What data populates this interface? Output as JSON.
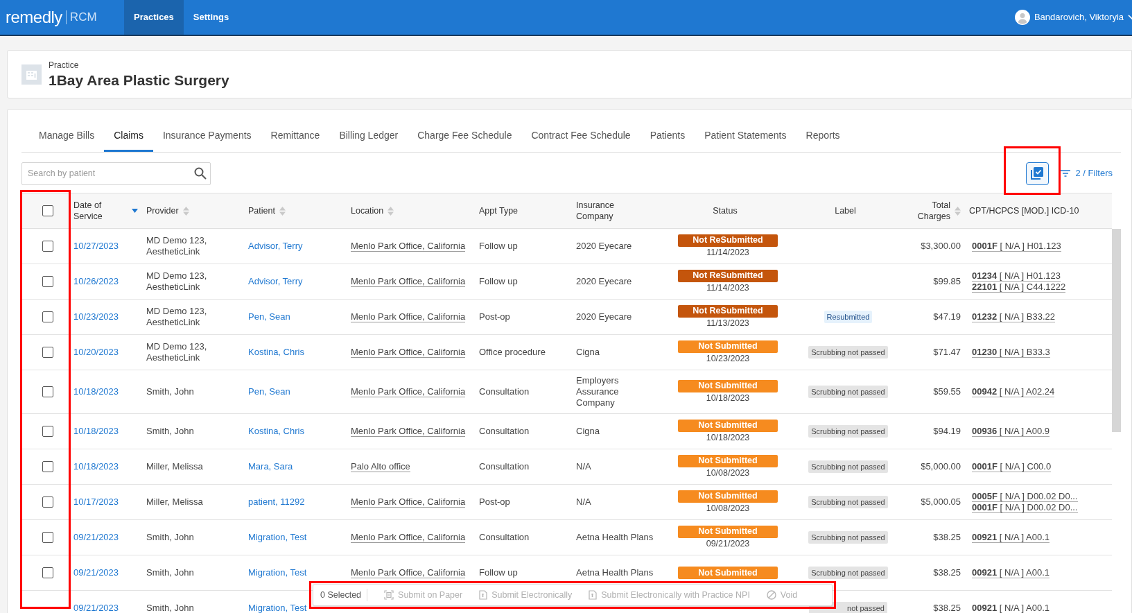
{
  "topbar": {
    "logo": "remedly",
    "product": "RCM",
    "nav": [
      {
        "label": "Practices",
        "selected": true
      },
      {
        "label": "Settings",
        "selected": false
      }
    ],
    "user": "Bandarovich, Viktoryia"
  },
  "practice": {
    "caption": "Practice",
    "name": "1Bay Area Plastic Surgery"
  },
  "tabs": [
    {
      "label": "Manage Bills",
      "selected": false
    },
    {
      "label": "Claims",
      "selected": true
    },
    {
      "label": "Insurance Payments",
      "selected": false
    },
    {
      "label": "Remittance",
      "selected": false
    },
    {
      "label": "Billing Ledger",
      "selected": false
    },
    {
      "label": "Charge Fee Schedule",
      "selected": false
    },
    {
      "label": "Contract Fee Schedule",
      "selected": false
    },
    {
      "label": "Patients",
      "selected": false
    },
    {
      "label": "Patient Statements",
      "selected": false
    },
    {
      "label": "Reports",
      "selected": false
    }
  ],
  "search": {
    "placeholder": "Search by patient"
  },
  "filters": {
    "label": "2 / Filters"
  },
  "table": {
    "select_all": {
      "checked": false
    },
    "columns": [
      {
        "label": "Date of Service",
        "sortable": true,
        "sorted": true
      },
      {
        "label": "Provider",
        "sortable": true,
        "sorted": false
      },
      {
        "label": "Patient",
        "sortable": true,
        "sorted": false
      },
      {
        "label": "Location",
        "sortable": true,
        "sorted": false
      },
      {
        "label": "Appt Type",
        "sortable": false
      },
      {
        "label": "Insurance Company",
        "sortable": false
      },
      {
        "label": "Status",
        "sortable": false
      },
      {
        "label": "Label",
        "sortable": false
      },
      {
        "label": "Total Charges",
        "sortable": true,
        "sorted": false
      },
      {
        "label": "CPT/HCPCS [MOD.] ICD-10",
        "sortable": false
      }
    ],
    "rows": [
      {
        "checked": false,
        "date": "10/27/2023",
        "provider": "MD Demo 123, AestheticLink",
        "patient": "Advisor, Terry",
        "location": "Menlo Park Office, California",
        "appt_type": "Follow up",
        "insurance": "2020 Eyecare",
        "status": {
          "text": "Not ReSubmitted",
          "date": "11/14/2023",
          "color": "#c4550c"
        },
        "charges": "$3,300.00",
        "codes": [
          "**0001F** [ N/A ] H01.123"
        ]
      },
      {
        "checked": false,
        "date": "10/26/2023",
        "provider": "MD Demo 123, AestheticLink",
        "patient": "Advisor, Terry",
        "location": "Menlo Park Office, California",
        "appt_type": "Follow up",
        "insurance": "2020 Eyecare",
        "status": {
          "text": "Not ReSubmitted",
          "date": "11/14/2023",
          "color": "#c4550c"
        },
        "charges": "$99.85",
        "codes": [
          "**01234** [ N/A ] H01.123",
          "**22101** [ N/A ] C44.1222"
        ]
      },
      {
        "checked": false,
        "date": "10/23/2023",
        "provider": "MD Demo 123, AestheticLink",
        "patient": "Pen, Sean",
        "location": "Menlo Park Office, California",
        "appt_type": "Post-op",
        "insurance": "2020 Eyecare",
        "status": {
          "text": "Not ReSubmitted",
          "date": "11/13/2023",
          "color": "#c4550c"
        },
        "label": {
          "text": "Resubmitted",
          "kind": "info"
        },
        "charges": "$47.19",
        "codes": [
          "**01232** [ N/A ] B33.22"
        ]
      },
      {
        "checked": false,
        "date": "10/20/2023",
        "provider": "MD Demo 123, AestheticLink",
        "patient": "Kostina, Chris",
        "location": "Menlo Park Office, California",
        "appt_type": "Office procedure",
        "insurance": "Cigna",
        "status": {
          "text": "Not Submitted",
          "date": "10/23/2023",
          "color": "#f68b1f"
        },
        "label": {
          "text": "Scrubbing not passed",
          "kind": "warning"
        },
        "charges": "$71.47",
        "codes": [
          "**01230** [ N/A ] B33.3"
        ]
      },
      {
        "checked": false,
        "date": "10/18/2023",
        "provider": "Smith, John",
        "patient": "Pen, Sean",
        "location": "Menlo Park Office, California",
        "appt_type": "Consultation",
        "insurance": "Employers Assurance Company",
        "status": {
          "text": "Not Submitted",
          "date": "10/18/2023",
          "color": "#f68b1f"
        },
        "label": {
          "text": "Scrubbing not passed",
          "kind": "warning"
        },
        "charges": "$59.55",
        "codes": [
          "**00942** [ N/A ] A02.24"
        ]
      },
      {
        "checked": false,
        "date": "10/18/2023",
        "provider": "Smith, John",
        "patient": "Kostina, Chris",
        "location": "Menlo Park Office, California",
        "appt_type": "Consultation",
        "insurance": "Cigna",
        "status": {
          "text": "Not Submitted",
          "date": "10/18/2023",
          "color": "#f68b1f"
        },
        "label": {
          "text": "Scrubbing not passed",
          "kind": "warning"
        },
        "charges": "$94.19",
        "codes": [
          "**00936** [ N/A ] A00.9"
        ]
      },
      {
        "checked": false,
        "date": "10/18/2023",
        "provider": "Miller, Melissa",
        "patient": "Mara, Sara",
        "location": "Palo Alto office",
        "appt_type": "Consultation",
        "insurance": "N/A",
        "status": {
          "text": "Not Submitted",
          "date": "10/08/2023",
          "color": "#f68b1f"
        },
        "label": {
          "text": "Scrubbing not passed",
          "kind": "warning"
        },
        "charges": "$5,000.00",
        "codes": [
          "**0001F** [ N/A ] C00.0"
        ]
      },
      {
        "checked": false,
        "date": "10/17/2023",
        "provider": "Miller, Melissa",
        "patient": "patient, 11292",
        "location": "Menlo Park Office, California",
        "appt_type": "Post-op",
        "insurance": "N/A",
        "status": {
          "text": "Not Submitted",
          "date": "10/08/2023",
          "color": "#f68b1f"
        },
        "label": {
          "text": "Scrubbing not passed",
          "kind": "warning"
        },
        "charges": "$5,000.05",
        "codes": [
          "**0005F** [ N/A ] D00.02 D0...",
          "**0001F** [ N/A ] D00.02 D0..."
        ]
      },
      {
        "checked": false,
        "date": "09/21/2023",
        "provider": "Smith, John",
        "patient": "Migration, Test",
        "location": "Menlo Park Office, California",
        "appt_type": "Consultation",
        "insurance": "Aetna Health Plans",
        "status": {
          "text": "Not Submitted",
          "date": "09/21/2023",
          "color": "#f68b1f"
        },
        "label": {
          "text": "Scrubbing not passed",
          "kind": "warning"
        },
        "charges": "$38.25",
        "codes": [
          "**00921** [ N/A ] A00.1"
        ]
      },
      {
        "checked": false,
        "date": "09/21/2023",
        "provider": "Smith, John",
        "patient": "Migration, Test",
        "location": "Menlo Park Office, California",
        "appt_type": "Follow up",
        "insurance": "Aetna Health Plans",
        "status": {
          "text": "Not Submitted",
          "color": "#f68b1f"
        },
        "label": {
          "text": "Scrubbing not passed",
          "kind": "warning"
        },
        "charges": "$38.25",
        "codes": [
          "**00921** [ N/A ] A00.1"
        ]
      },
      {
        "date": "09/21/2023",
        "provider": "Smith, John",
        "patient": "Migration, Test",
        "label": {
          "text": "not passed",
          "kind": "warning"
        },
        "charges": "$38.25",
        "codes": [
          "**00921** [ N/A ] A00.1"
        ]
      }
    ]
  },
  "action_bar": {
    "count": "0 Selected",
    "actions": [
      {
        "label": "Submit on Paper",
        "kind": "paper",
        "disabled": true
      },
      {
        "label": "Submit Electronically",
        "kind": "electronic",
        "disabled": true
      },
      {
        "label": "Submit Electronically with Practice NPI",
        "kind": "electronic",
        "disabled": true
      },
      {
        "label": "Void",
        "kind": "void",
        "disabled": true
      }
    ]
  }
}
